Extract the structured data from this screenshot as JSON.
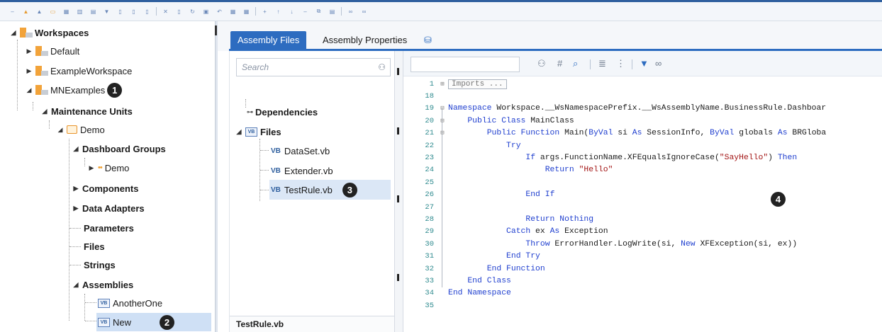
{
  "toolbar": {
    "icons": [
      "minus-icon",
      "flag-icon",
      "flag-icon",
      "folder-icon",
      "grid-icon",
      "chart-icon",
      "table-icon",
      "filter-icon",
      "doc-icon",
      "doc-icon",
      "doc-icon",
      "close-icon",
      "doc-icon",
      "refresh-icon",
      "save-icon",
      "undo-icon",
      "grid-icon",
      "calculator-icon",
      "plus-icon",
      "up-icon",
      "down-icon",
      "minus-icon",
      "copy-icon",
      "paste-icon",
      "link-icon",
      "glasses-icon"
    ]
  },
  "tree": {
    "workspaces_label": "Workspaces",
    "default_label": "Default",
    "example_workspace_label": "ExampleWorkspace",
    "mnexamples_label": "MNExamples",
    "maintenance_units_label": "Maintenance Units",
    "demo_label": "Demo",
    "dashboard_groups_label": "Dashboard Groups",
    "demo_group_label": "Demo",
    "components_label": "Components",
    "data_adapters_label": "Data Adapters",
    "parameters_label": "Parameters",
    "files_label": "Files",
    "strings_label": "Strings",
    "assemblies_label": "Assemblies",
    "another_one_label": "AnotherOne",
    "new_label": "New"
  },
  "badges": {
    "b1": "1",
    "b2": "2",
    "b3": "3",
    "b4": "4"
  },
  "tabs": {
    "assembly_files": "Assembly Files",
    "assembly_properties": "Assembly Properties"
  },
  "filepane": {
    "search_placeholder": "Search",
    "dependencies_label": "Dependencies",
    "files_label": "Files",
    "vb_tag": "VB",
    "files": [
      "DataSet.vb",
      "Extender.vb",
      "TestRule.vb"
    ],
    "footer_label": "TestRule.vb"
  },
  "editor": {
    "toolbar_icons": [
      "binoculars-icon",
      "hash-icon",
      "search-doc-icon",
      "comment-icon",
      "uncomment-icon",
      "filter-icon",
      "glasses-icon"
    ],
    "lines": [
      {
        "n": "1",
        "t": "Imports ..."
      },
      {
        "n": "18",
        "t": ""
      },
      {
        "n": "19",
        "t": "Namespace Workspace.__WsNamespacePrefix.__WsAssemblyName.BusinessRule.Dashboar"
      },
      {
        "n": "20",
        "t": "    Public Class MainClass"
      },
      {
        "n": "21",
        "t": "        Public Function Main(ByVal si As SessionInfo, ByVal globals As BRGloba"
      },
      {
        "n": "22",
        "t": "            Try"
      },
      {
        "n": "23",
        "t": "                If args.FunctionName.XFEqualsIgnoreCase(\"SayHello\") Then"
      },
      {
        "n": "24",
        "t": "                    Return \"Hello\""
      },
      {
        "n": "25",
        "t": ""
      },
      {
        "n": "26",
        "t": "                End If"
      },
      {
        "n": "27",
        "t": ""
      },
      {
        "n": "28",
        "t": "                Return Nothing"
      },
      {
        "n": "29",
        "t": "            Catch ex As Exception"
      },
      {
        "n": "30",
        "t": "                Throw ErrorHandler.LogWrite(si, New XFException(si, ex))"
      },
      {
        "n": "31",
        "t": "            End Try"
      },
      {
        "n": "32",
        "t": "        End Function"
      },
      {
        "n": "33",
        "t": "    End Class"
      },
      {
        "n": "34",
        "t": "End Namespace"
      },
      {
        "n": "35",
        "t": ""
      }
    ]
  }
}
